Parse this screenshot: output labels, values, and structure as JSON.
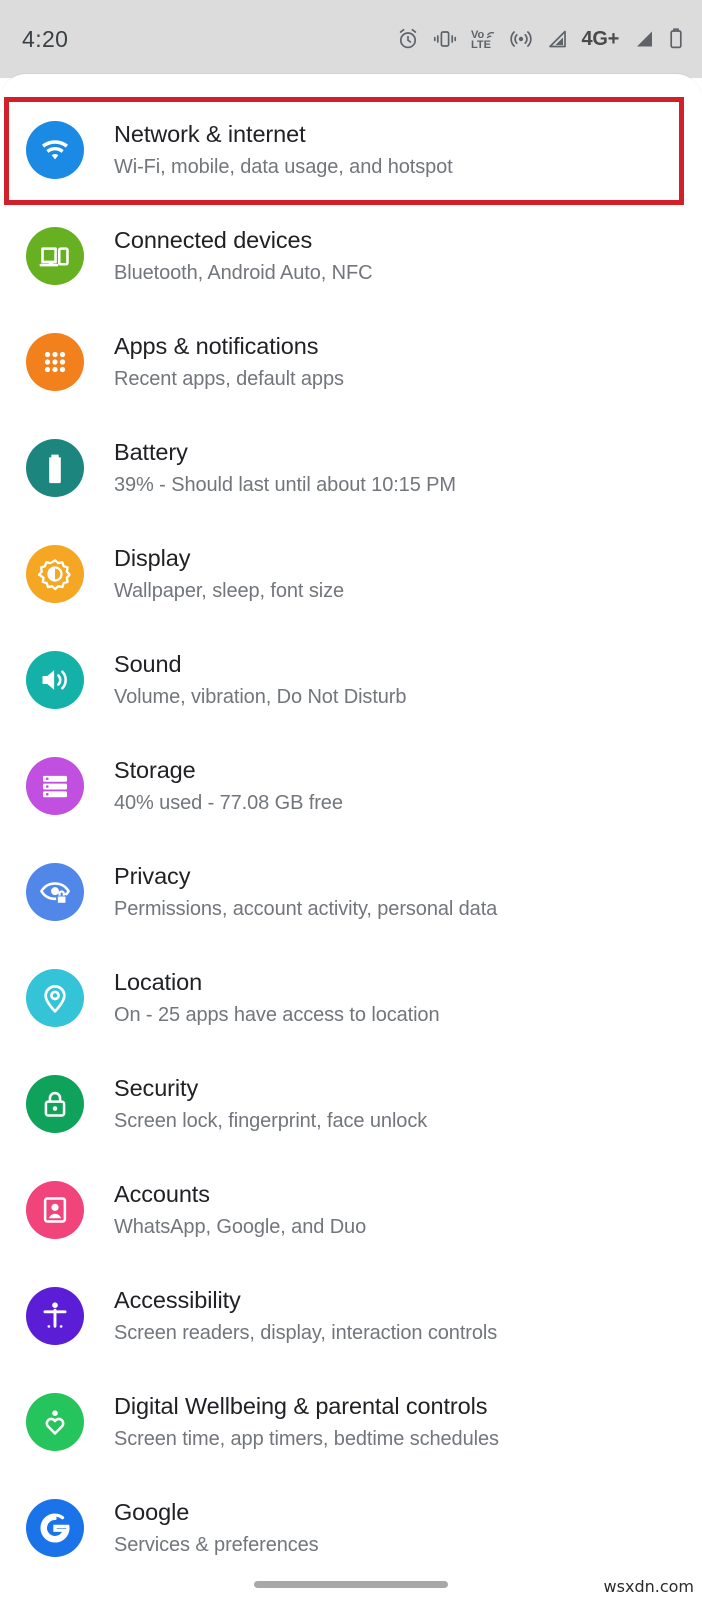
{
  "status_bar": {
    "time": "4:20",
    "network_label": "4G+",
    "icons": [
      "alarm-icon",
      "vibrate-icon",
      "volte-icon",
      "hotspot-icon",
      "signal-1-icon",
      "signal-2-icon",
      "battery-icon"
    ],
    "volte_top": "Vo",
    "volte_bottom": "LTE",
    "background_color": "#dcdcdc"
  },
  "highlight": {
    "color": "#d1202a",
    "target": "Network & internet"
  },
  "settings": {
    "items": [
      {
        "title": "Network & internet",
        "subtitle": "Wi-Fi, mobile, data usage, and hotspot",
        "icon": "wifi-icon",
        "color": "#1b8ae4"
      },
      {
        "title": "Connected devices",
        "subtitle": "Bluetooth, Android Auto, NFC",
        "icon": "devices-icon",
        "color": "#67b022"
      },
      {
        "title": "Apps & notifications",
        "subtitle": "Recent apps, default apps",
        "icon": "apps-grid-icon",
        "color": "#f2811d"
      },
      {
        "title": "Battery",
        "subtitle": "39% - Should last until about 10:15 PM",
        "icon": "battery-icon",
        "color": "#1c857d"
      },
      {
        "title": "Display",
        "subtitle": "Wallpaper, sleep, font size",
        "icon": "brightness-icon",
        "color": "#f5a623"
      },
      {
        "title": "Sound",
        "subtitle": "Volume, vibration, Do Not Disturb",
        "icon": "speaker-icon",
        "color": "#13b1a8"
      },
      {
        "title": "Storage",
        "subtitle": "40% used - 77.08 GB free",
        "icon": "storage-icon",
        "color": "#c150e0"
      },
      {
        "title": "Privacy",
        "subtitle": "Permissions, account activity, personal data",
        "icon": "eye-lock-icon",
        "color": "#5187e8"
      },
      {
        "title": "Location",
        "subtitle": "On - 25 apps have access to location",
        "icon": "map-pin-icon",
        "color": "#35c3d8"
      },
      {
        "title": "Security",
        "subtitle": "Screen lock, fingerprint, face unlock",
        "icon": "lock-icon",
        "color": "#0ea25a"
      },
      {
        "title": "Accounts",
        "subtitle": "WhatsApp, Google, and Duo",
        "icon": "account-card-icon",
        "color": "#f0447a"
      },
      {
        "title": "Accessibility",
        "subtitle": "Screen readers, display, interaction controls",
        "icon": "accessibility-icon",
        "color": "#5b1ed6"
      },
      {
        "title": "Digital Wellbeing & parental controls",
        "subtitle": "Screen time, app timers, bedtime schedules",
        "icon": "wellbeing-heart-icon",
        "color": "#25c45c"
      },
      {
        "title": "Google",
        "subtitle": "Services & preferences",
        "icon": "google-g-icon",
        "color": "#1a73e8"
      }
    ]
  },
  "navigation": {
    "handle_label": "home-gesture-handle"
  },
  "watermark": {
    "text": "wsxdn.com"
  }
}
